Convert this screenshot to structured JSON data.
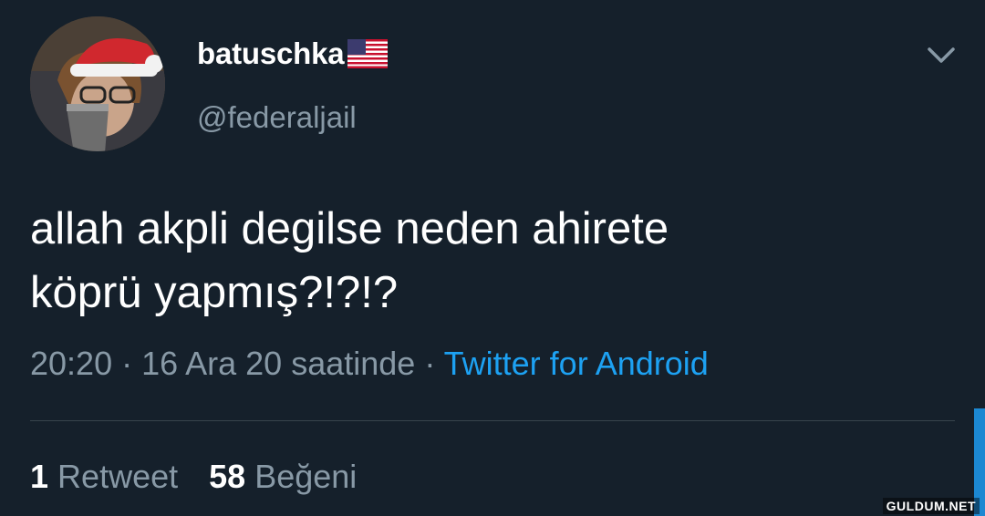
{
  "user": {
    "display_name": "batuschka",
    "flag_icon": "us-flag-icon",
    "handle": "@federaljail",
    "avatar": "user-avatar"
  },
  "tweet": {
    "line1": "allah akpli degilse neden ahirete",
    "line2": "köprü yapmış?!?!?",
    "time": "20:20 · 16 Ara 20 saatinde · ",
    "source": "Twitter for Android"
  },
  "stats": {
    "retweet_count": "1",
    "retweet_label": "Retweet",
    "like_count": "58",
    "like_label": "Beğeni"
  },
  "menu": {
    "icon": "chevron-down-icon"
  },
  "watermark": "GULDUM.NET",
  "colors": {
    "background": "#15202b",
    "secondary_text": "#8899a6",
    "accent": "#1da1f2"
  }
}
